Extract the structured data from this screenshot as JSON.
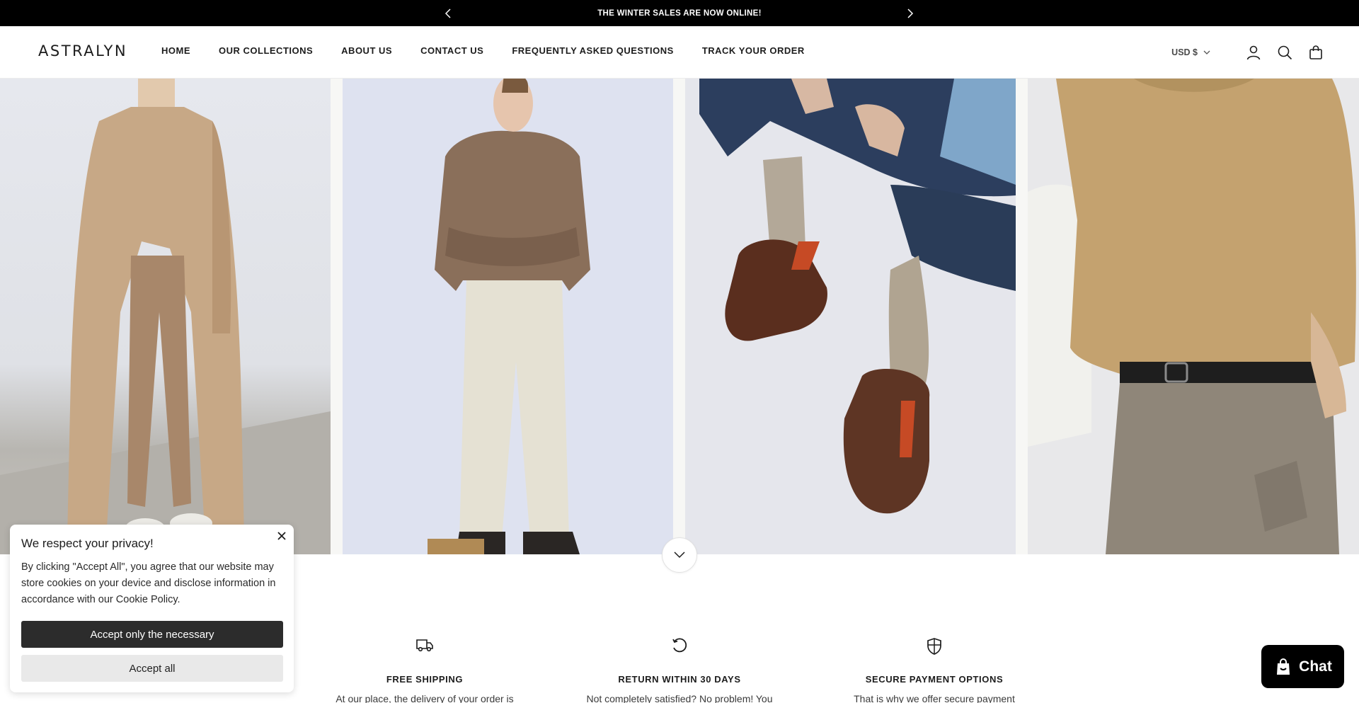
{
  "announcement": {
    "text": "THE WINTER SALES ARE NOW ONLINE!",
    "prev_icon": "chevron-left-icon",
    "next_icon": "chevron-right-icon"
  },
  "header": {
    "logo": "ASTRALYN",
    "nav": [
      {
        "label": "HOME"
      },
      {
        "label": "OUR COLLECTIONS"
      },
      {
        "label": "ABOUT US"
      },
      {
        "label": "CONTACT US"
      },
      {
        "label": "FREQUENTLY ASKED QUESTIONS"
      },
      {
        "label": "TRACK YOUR ORDER"
      }
    ],
    "currency": "USD $",
    "icons": [
      "account-icon",
      "search-icon",
      "cart-icon"
    ]
  },
  "hero": {
    "panels": [
      "model-in-camel-coat",
      "model-in-brown-sweater",
      "clogs-and-socks",
      "knit-sweater-closeup"
    ],
    "scroll_icon": "chevron-down-icon"
  },
  "features": [
    {
      "icon": "truck-icon",
      "title": "FREE SHIPPING",
      "desc": "At our place, the delivery of your order is"
    },
    {
      "icon": "return-icon",
      "title": "RETURN WITHIN 30 DAYS",
      "desc": "Not completely satisfied? No problem! You"
    },
    {
      "icon": "shield-icon",
      "title": "SECURE PAYMENT OPTIONS",
      "desc": "That is why we offer secure payment"
    }
  ],
  "cookie": {
    "title": "We respect your privacy!",
    "body": "By clicking \"Accept All\", you agree that our website may store cookies on your device and disclose information in accordance with our Cookie Policy.",
    "btn_necessary": "Accept only the necessary",
    "btn_all": "Accept all"
  },
  "chat": {
    "label": "Chat"
  },
  "colors": {
    "announcement_bg": "#000000",
    "button_dark": "#2c2c2c",
    "chat_bg": "#000000"
  }
}
